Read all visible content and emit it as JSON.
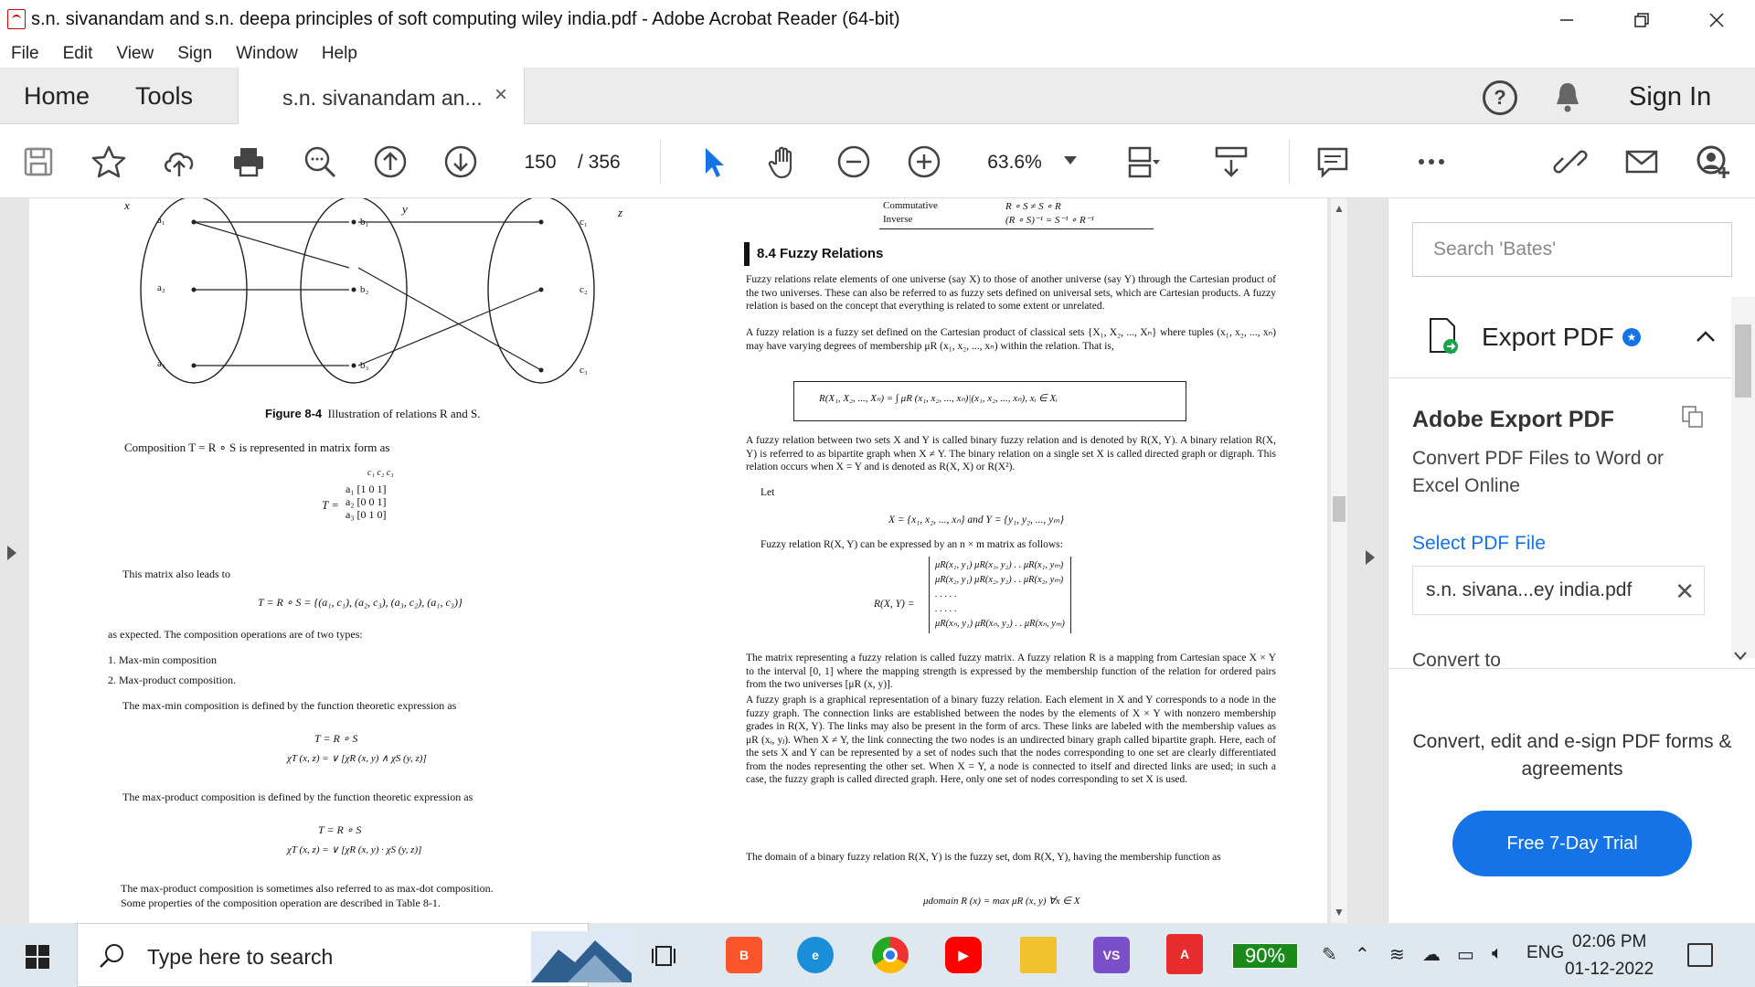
{
  "window": {
    "title": "s.n. sivanandam and s.n. deepa principles of soft computing wiley india.pdf - Adobe Acrobat Reader (64-bit)"
  },
  "menu": [
    "File",
    "Edit",
    "View",
    "Sign",
    "Window",
    "Help"
  ],
  "tabs": {
    "home": "Home",
    "tools": "Tools",
    "document": "s.n. sivanandam an...",
    "close": "×",
    "sign_in": "Sign In"
  },
  "toolbar": {
    "page_current": "150",
    "page_total": "/  356",
    "zoom": "63.6%"
  },
  "document": {
    "left": {
      "figure_caption_bold": "Figure 8-4",
      "figure_caption": "Illustration of relations R and S.",
      "composition_line": "Composition T = R ∘ S is represented in matrix form as",
      "matrix_T": "T =",
      "matrix_rows": [
        "a₁ [1  0  1]",
        "a₂ [0  0  1]",
        "a₃ [0  1  0]"
      ],
      "matrix_cols": "c₁  c₂  c₃",
      "leads_to": "This matrix also leads to",
      "composition_set": "T = R ∘ S = {(a₁, c₁), (a₂, c₃), (a₃, c₂), (a₁, c₃)}",
      "expected": "as expected. The composition operations are of two types:",
      "list": [
        "1.  Max-min composition",
        "2.  Max-product composition."
      ],
      "maxmin_def": "The max-min composition is defined by the function theoretic expression as",
      "maxmin_eq1": "T = R ∘ S",
      "maxmin_eq2": "χT (x, z) =  ∨  [χR (x, y) ∧ χS (y, z)]",
      "maxproduct_def": "The max-product composition is defined by the function theoretic expression as",
      "maxproduct_eq1": "T = R ∘ S",
      "maxproduct_eq2": "χT (x, z) =  ∨  [χR (x, y) · χS (y, z)]",
      "maxdot_line1": "The max-product composition is sometimes also referred to as max-dot composition.",
      "maxdot_line2": "Some properties of the composition operation are described in Table 8-1."
    },
    "right": {
      "table_row1": "Commutative",
      "table_row1_val": "R ∘ S ≠ S ∘ R",
      "table_row2": "Inverse",
      "table_row2_val": "(R ∘ S)⁻¹ = S⁻¹ ∘ R⁻¹",
      "section_title": "8.4  Fuzzy Relations",
      "para1": "Fuzzy relations relate elements of one universe (say X) to those of another universe (say Y) through the Cartesian product of the two universes. These can also be referred to as fuzzy sets defined on universal sets, which are Cartesian products. A fuzzy relation is based on the concept that everything is related to some extent or unrelated.",
      "para2": "A fuzzy relation is a fuzzy set defined on the Cartesian product of classical sets {X₁, X₂, ..., Xₙ} where tuples (x₁, x₂, ..., xₙ) may have varying degrees of membership μR (x₁, x₂, ..., xₙ) within the relation. That is,",
      "integral_eq": "R(X₁, X₂, ..., Xₙ) =  ∫  μR (x₁, x₂, ..., xₙ)|(x₁, x₂, ..., xₙ),   xᵢ ∈ Xᵢ",
      "para3": "A fuzzy relation between two sets X and Y is called binary fuzzy relation and is denoted by R(X, Y). A binary relation R(X, Y) is referred to as bipartite graph when X ≠ Y. The binary relation on a single set X is called directed graph or digraph. This relation occurs when X = Y and is denoted as R(X, X) or R(X²).",
      "let": "Let",
      "sets_eq": "X = {x₁, x₂, ..., xₙ}   and   Y = {y₁, y₂, ..., yₘ}",
      "matrix_intro": "Fuzzy relation R(X, Y) can be expressed by an n × m matrix as follows:",
      "matrix_label": "R(X, Y) =",
      "matrix_rows": [
        "μR(x₁, y₁)   μR(x₁, y₂)   .  .   μR(x₁, yₘ)",
        "μR(x₂, y₁)   μR(x₂, y₂)   .  .   μR(x₂, yₘ)",
        ".                  .                   .  .      .",
        ".                  .                   .  .      .",
        "μR(xₙ, y₁)   μR(xₙ, y₂)   .  .   μR(xₙ, yₘ)"
      ],
      "para4": "The matrix representing a fuzzy relation is called fuzzy matrix. A fuzzy relation R is a mapping from Cartesian space X × Y to the interval [0, 1] where the mapping strength is expressed by the membership function of the relation for ordered pairs from the two universes [μR (x, y)].",
      "para5": "A fuzzy graph is a graphical representation of a binary fuzzy relation. Each element in X and Y corresponds to a node in the fuzzy graph. The connection links are established between the nodes by the elements of X × Y with nonzero membership grades in R(X, Y). The links may also be present in the form of arcs. These links are labeled with the membership values as μR (xᵢ, yⱼ). When X ≠ Y, the link connecting the two nodes is an undirected binary graph called bipartite graph. Here, each of the sets X and Y can be represented by a set of nodes such that the nodes corresponding to one set are clearly differentiated from the nodes representing the other set. When X = Y, a node is connected to itself and directed links are used; in such a case, the fuzzy graph is called directed graph. Here, only one set of nodes corresponding to set X is used.",
      "para6": "The domain of a binary fuzzy relation R(X, Y) is the fuzzy set, dom R(X, Y), having the membership function as",
      "domain_eq": "μdomain R (x) = max μR (x, y)   ∀x ∈ X"
    },
    "figure_labels": {
      "x": "x",
      "y": "y",
      "z": "z",
      "a": [
        "a₁",
        "a₂",
        "a₃"
      ],
      "b": [
        "b₁",
        "b₂",
        "b₃"
      ],
      "c": [
        "c₁",
        "c₂",
        "c₃"
      ]
    }
  },
  "right_panel": {
    "search_placeholder": "Search 'Bates'",
    "export_pdf": "Export PDF",
    "adobe_export_title": "Adobe Export PDF",
    "adobe_export_desc": "Convert PDF Files to Word or Excel Online",
    "select_pdf": "Select PDF File",
    "file_name": "s.n. sivana...ey india.pdf",
    "convert_to": "Convert to",
    "promo": "Convert, edit and e-sign PDF forms & agreements",
    "trial_button": "Free 7-Day Trial"
  },
  "taskbar": {
    "search_placeholder": "Type here to search",
    "battery": "90%",
    "language": "ENG",
    "time": "02:06 PM",
    "date": "01-12-2022"
  }
}
